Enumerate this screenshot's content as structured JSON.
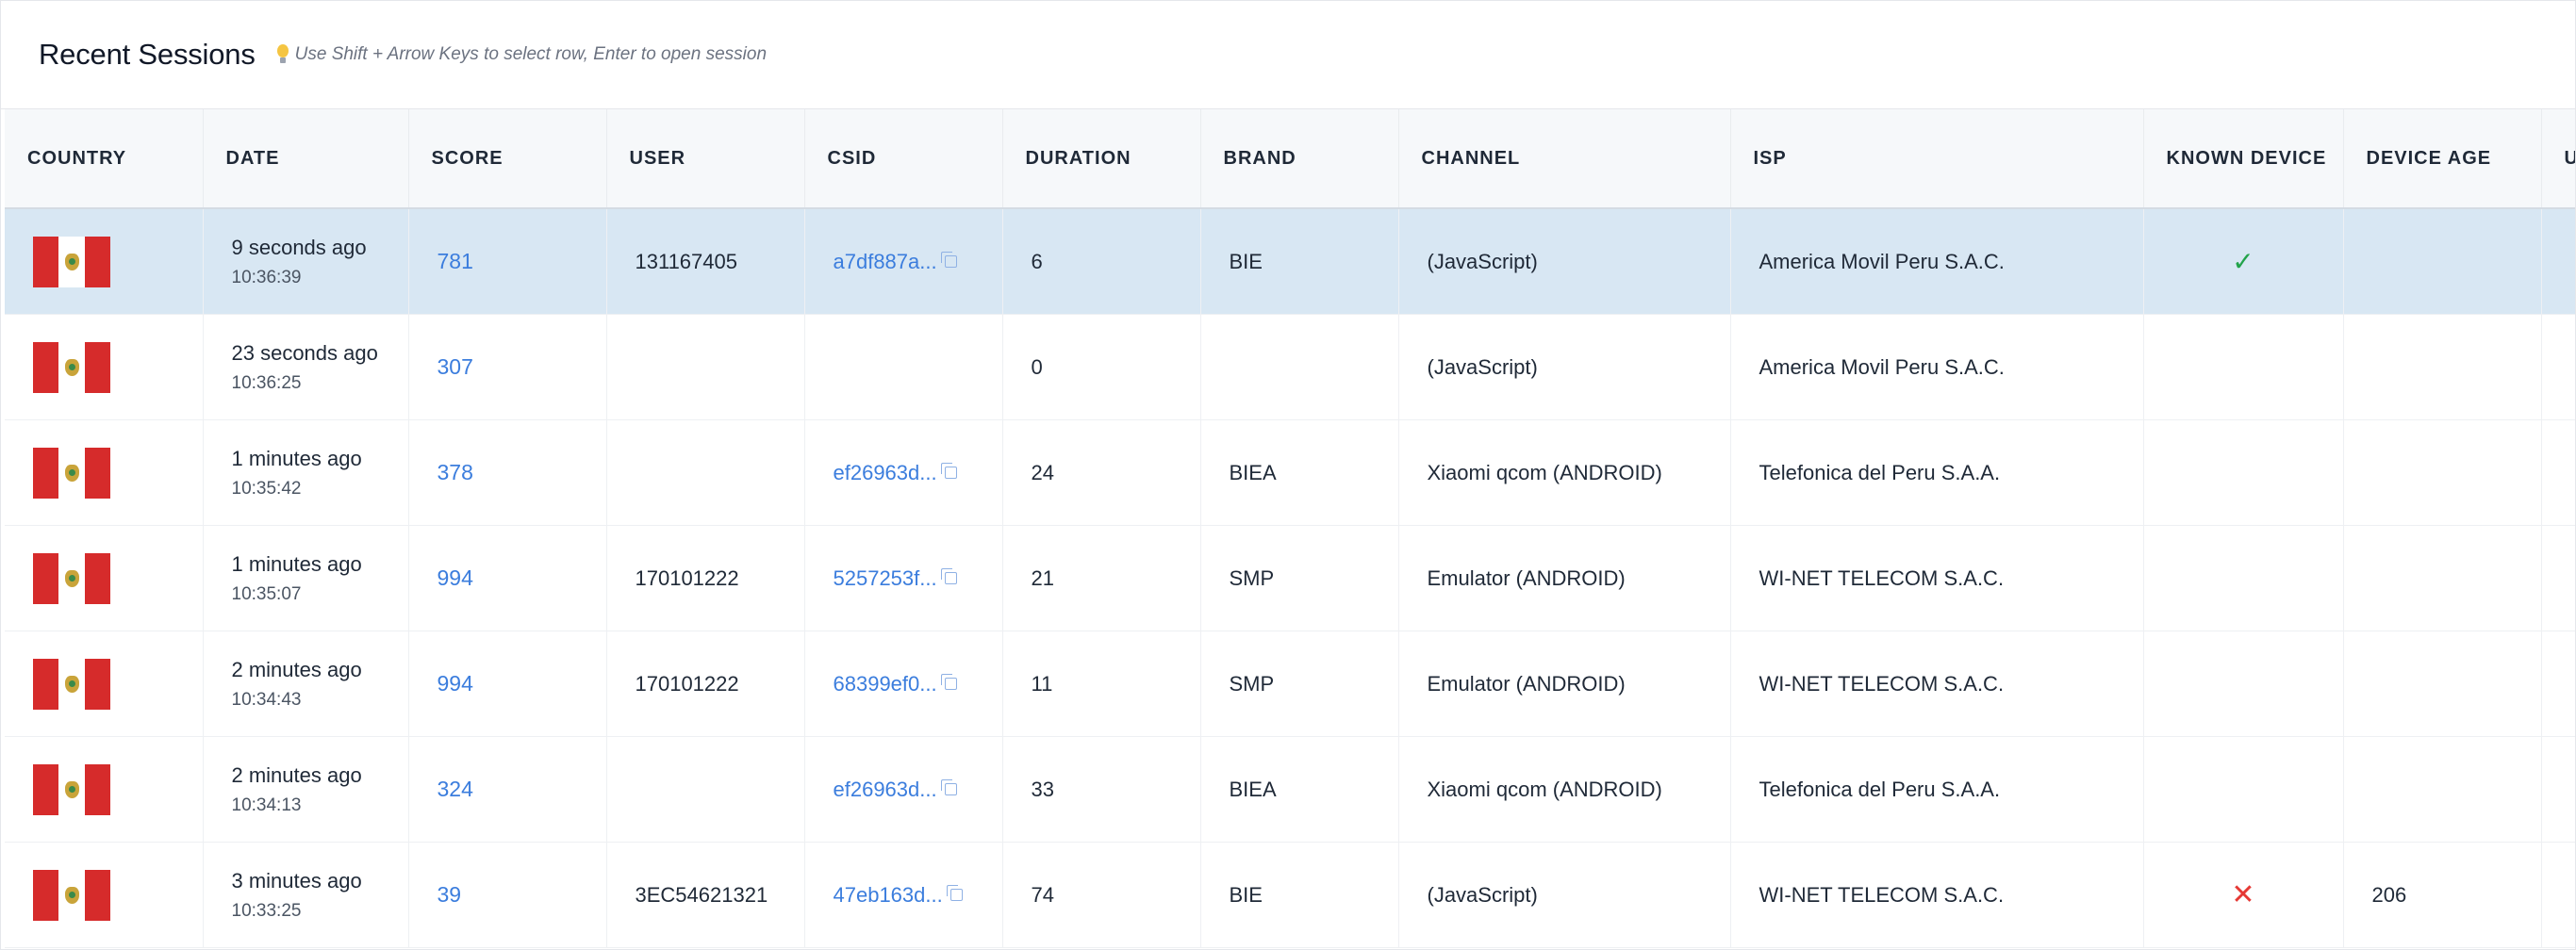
{
  "header": {
    "title": "Recent Sessions",
    "hint": "Use Shift + Arrow Keys to select row, Enter to open session"
  },
  "columns": [
    "COUNTRY",
    "DATE",
    "SCORE",
    "USER",
    "CSID",
    "DURATION",
    "BRAND",
    "CHANNEL",
    "ISP",
    "KNOWN DEVICE",
    "DEVICE AGE",
    "U"
  ],
  "rows": [
    {
      "date_rel": "9 seconds ago",
      "time": "10:36:39",
      "score": "781",
      "user": "131167405",
      "csid": "a7df887a...",
      "duration": "6",
      "brand": "BIE",
      "channel": "(JavaScript)",
      "isp": "America Movil Peru S.A.C.",
      "known_device": "check",
      "device_age": ""
    },
    {
      "date_rel": "23 seconds ago",
      "time": "10:36:25",
      "score": "307",
      "user": "",
      "csid": "",
      "duration": "0",
      "brand": "",
      "channel": "(JavaScript)",
      "isp": "America Movil Peru S.A.C.",
      "known_device": "",
      "device_age": ""
    },
    {
      "date_rel": "1 minutes ago",
      "time": "10:35:42",
      "score": "378",
      "user": "",
      "csid": "ef26963d...",
      "duration": "24",
      "brand": "BIEA",
      "channel": "Xiaomi qcom (ANDROID)",
      "isp": "Telefonica del Peru S.A.A.",
      "known_device": "",
      "device_age": ""
    },
    {
      "date_rel": "1 minutes ago",
      "time": "10:35:07",
      "score": "994",
      "user": "170101222",
      "csid": "5257253f...",
      "duration": "21",
      "brand": "SMP",
      "channel": "Emulator (ANDROID)",
      "isp": "WI-NET TELECOM S.A.C.",
      "known_device": "",
      "device_age": ""
    },
    {
      "date_rel": "2 minutes ago",
      "time": "10:34:43",
      "score": "994",
      "user": "170101222",
      "csid": "68399ef0...",
      "duration": "11",
      "brand": "SMP",
      "channel": "Emulator (ANDROID)",
      "isp": "WI-NET TELECOM S.A.C.",
      "known_device": "",
      "device_age": ""
    },
    {
      "date_rel": "2 minutes ago",
      "time": "10:34:13",
      "score": "324",
      "user": "",
      "csid": "ef26963d...",
      "duration": "33",
      "brand": "BIEA",
      "channel": "Xiaomi qcom (ANDROID)",
      "isp": "Telefonica del Peru S.A.A.",
      "known_device": "",
      "device_age": ""
    },
    {
      "date_rel": "3 minutes ago",
      "time": "10:33:25",
      "score": "39",
      "user": "3EC54621321",
      "csid": "47eb163d...",
      "duration": "74",
      "brand": "BIE",
      "channel": "(JavaScript)",
      "isp": "WI-NET TELECOM S.A.C.",
      "known_device": "cross",
      "device_age": "206"
    }
  ],
  "icons": {
    "hint": "lightbulb-icon",
    "flag": "peru-flag-icon",
    "copy": "copy-icon",
    "check": "check-icon",
    "cross": "cross-icon"
  },
  "colors": {
    "accent_link": "#3b7ddd",
    "selected_row": "#d8e7f3",
    "check": "#22a34a",
    "cross": "#e53935",
    "flag_red": "#d62b2b"
  }
}
